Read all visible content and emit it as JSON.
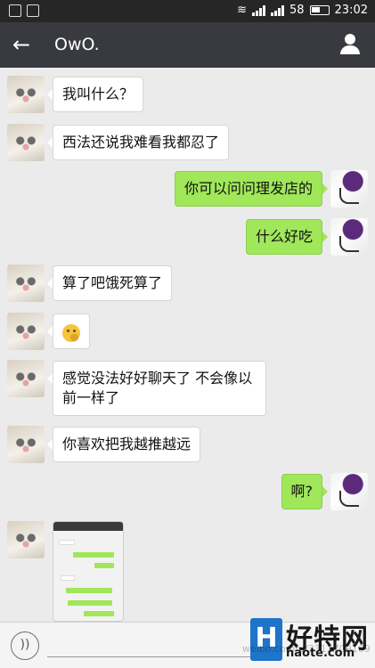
{
  "status_bar": {
    "battery": "58",
    "time": "23:02",
    "icons": [
      "notification-icon",
      "image-icon",
      "wifi-icon",
      "signal-icon",
      "battery-icon"
    ]
  },
  "header": {
    "title": "OwO.",
    "back_icon": "back-arrow-icon",
    "profile_icon": "person-icon"
  },
  "messages": [
    {
      "side": "in",
      "text": "我叫什么？"
    },
    {
      "side": "in",
      "text": "西法还说我难看我都忍了"
    },
    {
      "side": "out",
      "text": "你可以问问理发店的"
    },
    {
      "side": "out",
      "text": "什么好吃"
    },
    {
      "side": "in",
      "text": "算了吧饿死算了"
    },
    {
      "side": "in",
      "emoji": "thinking-face-emoji"
    },
    {
      "side": "in",
      "text": "感觉没法好好聊天了 不会像以前一样了"
    },
    {
      "side": "in",
      "text": "你喜欢把我越推越远"
    },
    {
      "side": "out",
      "text": "啊?"
    },
    {
      "side": "in",
      "image": "chat-screenshot-thumbnail"
    }
  ],
  "input_bar": {
    "voice_icon": "voice-icon",
    "value": ""
  },
  "watermark": {
    "logo": "H",
    "title": "好特网",
    "url": "haote.com",
    "faint_text": "weibo.com/u/3312709169"
  },
  "colors": {
    "titlebar": "#393a3f",
    "statusbar": "#262626",
    "outgoing_bubble": "#a0e75a",
    "incoming_bubble": "#ffffff",
    "background": "#ebebeb"
  }
}
